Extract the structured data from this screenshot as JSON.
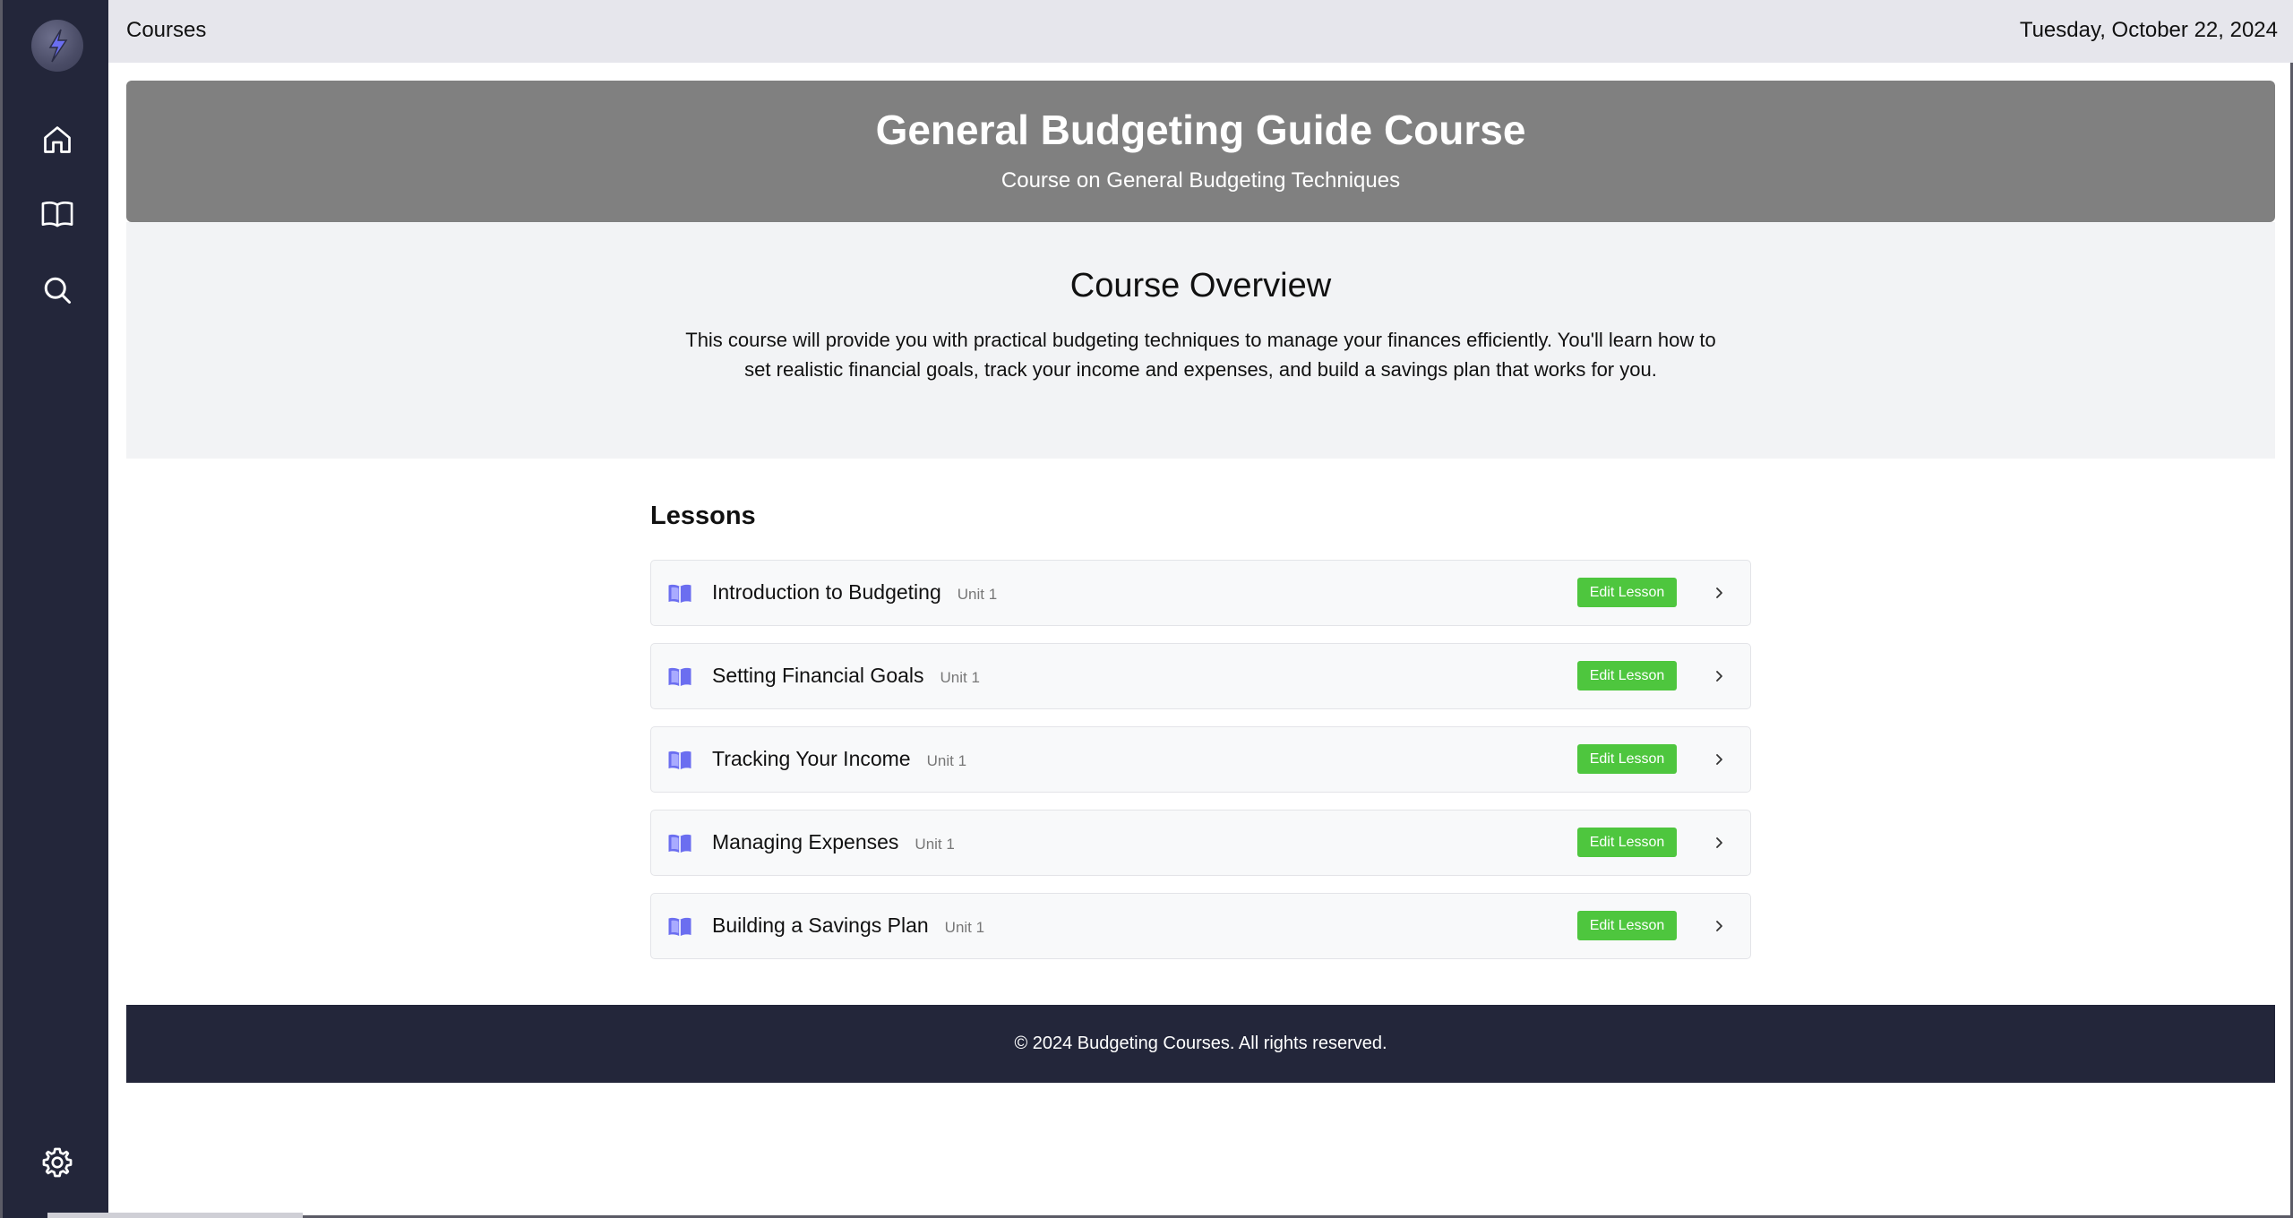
{
  "sidebar": {
    "items": [
      {
        "icon": "home-icon"
      },
      {
        "icon": "book-icon"
      },
      {
        "icon": "search-icon"
      }
    ],
    "bottom_icon": "gear-icon"
  },
  "topbar": {
    "breadcrumb": "Courses",
    "date": "Tuesday, October 22, 2024"
  },
  "hero": {
    "title": "General Budgeting Guide Course",
    "subtitle": "Course on General Budgeting Techniques"
  },
  "overview": {
    "heading": "Course Overview",
    "body": "This course will provide you with practical budgeting techniques to manage your finances efficiently. You'll learn how to set realistic financial goals, track your income and expenses, and build a savings plan that works for you."
  },
  "lessons": {
    "heading": "Lessons",
    "edit_label": "Edit Lesson",
    "items": [
      {
        "title": "Introduction to Budgeting",
        "unit": "Unit 1"
      },
      {
        "title": "Setting Financial Goals",
        "unit": "Unit 1"
      },
      {
        "title": "Tracking Your Income",
        "unit": "Unit 1"
      },
      {
        "title": "Managing Expenses",
        "unit": "Unit 1"
      },
      {
        "title": "Building a Savings Plan",
        "unit": "Unit 1"
      }
    ]
  },
  "footer": {
    "text": "© 2024 Budgeting Courses. All rights reserved."
  },
  "colors": {
    "sidebar": "#23263a",
    "accent_icon": "#6b6ef0",
    "edit_button": "#4ec63e",
    "hero": "#808080"
  }
}
